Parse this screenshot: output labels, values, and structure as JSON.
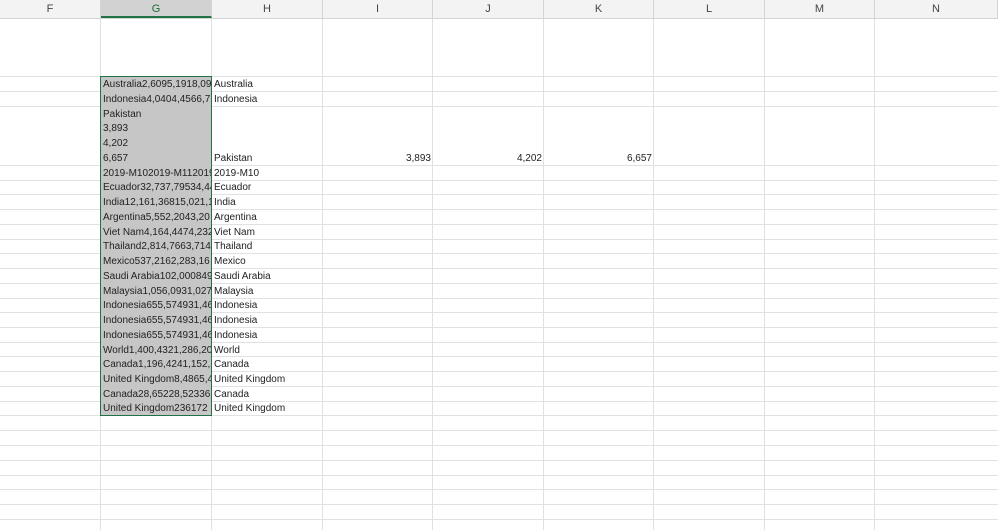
{
  "columns": [
    "F",
    "G",
    "H",
    "I",
    "J",
    "K",
    "L",
    "M",
    "N"
  ],
  "selected_column": "G",
  "g_top_block": [
    "Pakistan",
    "3,893",
    "4,202",
    "6,657"
  ],
  "rows": [
    {
      "g": "Australia2,6095,1918,09",
      "h": "Australia"
    },
    {
      "g": "Indonesia4,0404,4566,7",
      "h": "Indonesia"
    },
    {
      "g": "",
      "h": "Pakistan",
      "i": "3,893",
      "j": "4,202",
      "k": "6,657"
    },
    {
      "g": "2019-M102019-M112019",
      "h": "2019-M10"
    },
    {
      "g": "Ecuador32,737,79534,44",
      "h": "Ecuador"
    },
    {
      "g": "India12,161,36815,021,1",
      "h": "India"
    },
    {
      "g": "Argentina5,552,2043,20",
      "h": "Argentina"
    },
    {
      "g": "Viet Nam4,164,4474,232",
      "h": "Viet Nam"
    },
    {
      "g": "Thailand2,814,7663,714,",
      "h": "Thailand"
    },
    {
      "g": "Mexico537,2162,283,16",
      "h": "Mexico"
    },
    {
      "g": "Saudi Arabia102,000849,",
      "h": "Saudi Arabia"
    },
    {
      "g": "Malaysia1,056,0931,027,",
      "h": "Malaysia"
    },
    {
      "g": "Indonesia655,574931,46",
      "h": "Indonesia"
    },
    {
      "g": "Indonesia655,574931,46",
      "h": "Indonesia"
    },
    {
      "g": "Indonesia655,574931,46",
      "h": "Indonesia"
    },
    {
      "g": "World1,400,4321,286,20",
      "h": "World"
    },
    {
      "g": "Canada1,196,4241,152,2",
      "h": "Canada"
    },
    {
      "g": "United Kingdom8,4865,4",
      "h": "United Kingdom"
    },
    {
      "g": "Canada28,65228,52336,0",
      "h": "Canada"
    },
    {
      "g": "United Kingdom236172",
      "h": "United Kingdom"
    }
  ]
}
